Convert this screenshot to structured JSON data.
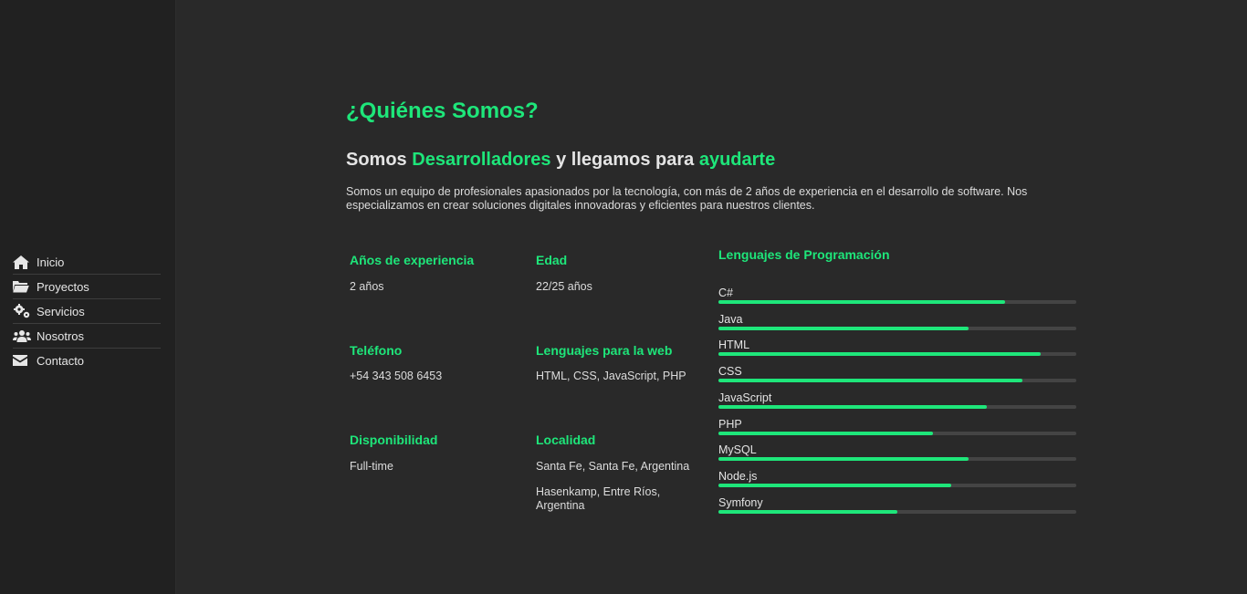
{
  "nav": {
    "items": [
      {
        "label": "Inicio",
        "icon": "home-icon"
      },
      {
        "label": "Proyectos",
        "icon": "folder-open-icon"
      },
      {
        "label": "Servicios",
        "icon": "gears-icon"
      },
      {
        "label": "Nosotros",
        "icon": "users-icon"
      },
      {
        "label": "Contacto",
        "icon": "envelope-icon"
      }
    ]
  },
  "about": {
    "title": "¿Quiénes Somos?",
    "subtitle_part1": "Somos ",
    "subtitle_highlight1": "Desarrolladores",
    "subtitle_part2": " y llegamos para ",
    "subtitle_highlight2": "ayudarte",
    "description": "Somos un equipo de profesionales apasionados por la tecnología, con más de 2 años de experiencia en el desarrollo de software. Nos especializamos en crear soluciones digitales innovadoras y eficientes para nuestros clientes."
  },
  "info": {
    "experience": {
      "label": "Años de experiencia",
      "value": "2 años"
    },
    "age": {
      "label": "Edad",
      "value": "22/25 años"
    },
    "phone": {
      "label": "Teléfono",
      "value": "+54 343 508 6453"
    },
    "web_languages": {
      "label": "Lenguajes para la web",
      "value": "HTML, CSS, JavaScript, PHP"
    },
    "availability": {
      "label": "Disponibilidad",
      "value": "Full-time"
    },
    "location": {
      "label": "Localidad",
      "value1": "Santa Fe, Santa Fe, Argentina",
      "value2": "Hasenkamp, Entre Ríos, Argentina"
    }
  },
  "languages": {
    "title": "Lenguajes de Programación",
    "items": [
      {
        "name": "C#",
        "level": 80
      },
      {
        "name": "Java",
        "level": 70
      },
      {
        "name": "HTML",
        "level": 90
      },
      {
        "name": "CSS",
        "level": 85
      },
      {
        "name": "JavaScript",
        "level": 75
      },
      {
        "name": "PHP",
        "level": 60
      },
      {
        "name": "MySQL",
        "level": 70
      },
      {
        "name": "Node.js",
        "level": 65
      },
      {
        "name": "Symfony",
        "level": 50
      }
    ]
  },
  "colors": {
    "accent": "#1ee67a",
    "background": "#292929",
    "sidebar": "#212121"
  }
}
